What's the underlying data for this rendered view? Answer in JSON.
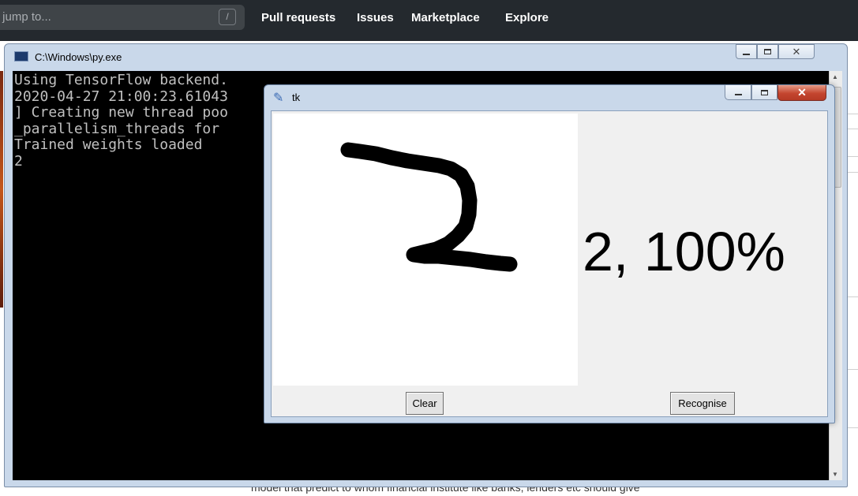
{
  "github": {
    "search_placeholder": "r jump to...",
    "slash_key": "/",
    "nav": [
      "Pull requests",
      "Issues",
      "Marketplace",
      "Explore"
    ]
  },
  "console": {
    "title": "C:\\Windows\\py.exe",
    "lines": [
      "Using TensorFlow backend.",
      "2020-04-27 21:00:23.61043",
      "] Creating new thread poo",
      "_parallelism_threads for",
      "Trained weights loaded",
      "2"
    ]
  },
  "tk": {
    "title": "tk",
    "result": "2, 100%",
    "clear_label": "Clear",
    "recognise_label": "Recognise"
  },
  "background_text": "model that predict to whom financial institute like banks, lenders etc should give",
  "colors": {
    "github_header": "#24292e",
    "console_bg": "#000000",
    "console_text": "#c0c0c0",
    "close_button": "#c4452f"
  },
  "icons": {
    "console_icon": "terminal-icon",
    "tk_icon": "feather-icon"
  }
}
